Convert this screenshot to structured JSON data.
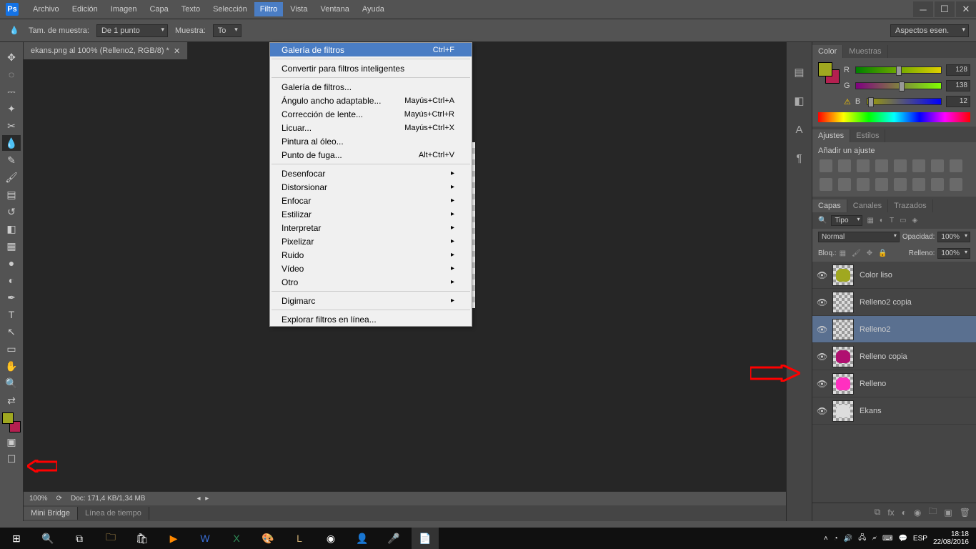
{
  "menubar": [
    "Archivo",
    "Edición",
    "Imagen",
    "Capa",
    "Texto",
    "Selección",
    "Filtro",
    "Vista",
    "Ventana",
    "Ayuda"
  ],
  "options": {
    "sample_label": "Tam. de muestra:",
    "sample_value": "De 1 punto",
    "muestra_label": "Muestra:",
    "muestra_value": "To",
    "workspace": "Aspectos esen."
  },
  "doc_tab": "ekans.png al 100% (Relleno2, RGB/8) *",
  "filter_menu": {
    "highlight": {
      "label": "Galería de filtros",
      "shortcut": "Ctrl+F"
    },
    "convert": "Convertir para filtros inteligentes",
    "g1": [
      {
        "label": "Galería de filtros...",
        "shortcut": ""
      },
      {
        "label": "Ángulo ancho adaptable...",
        "shortcut": "Mayús+Ctrl+A"
      },
      {
        "label": "Corrección de lente...",
        "shortcut": "Mayús+Ctrl+R"
      },
      {
        "label": "Licuar...",
        "shortcut": "Mayús+Ctrl+X"
      },
      {
        "label": "Pintura al óleo...",
        "shortcut": ""
      },
      {
        "label": "Punto de fuga...",
        "shortcut": "Alt+Ctrl+V"
      }
    ],
    "sub": [
      "Desenfocar",
      "Distorsionar",
      "Enfocar",
      "Estilizar",
      "Interpretar",
      "Pixelizar",
      "Ruido",
      "Vídeo",
      "Otro"
    ],
    "digimarc": "Digimarc",
    "browse": "Explorar filtros en línea..."
  },
  "status": {
    "zoom": "100%",
    "doc": "Doc: 171,4 KB/1,34 MB"
  },
  "bottom_tabs": [
    "Mini Bridge",
    "Línea de tiempo"
  ],
  "color_panel": {
    "tabs": [
      "Color",
      "Muestras"
    ],
    "r": {
      "label": "R",
      "val": "128"
    },
    "g": {
      "label": "G",
      "val": "138"
    },
    "b": {
      "label": "B",
      "val": "12"
    }
  },
  "adjust": {
    "tabs": [
      "Ajustes",
      "Estilos"
    ],
    "title": "Añadir un ajuste"
  },
  "layers_panel": {
    "tabs": [
      "Capas",
      "Canales",
      "Trazados"
    ],
    "kind": "Tipo",
    "blend": "Normal",
    "opacity_label": "Opacidad:",
    "opacity_val": "100%",
    "lock_label": "Bloq.:",
    "fill_label": "Relleno:",
    "fill_val": "100%",
    "layers": [
      {
        "name": "Color liso",
        "color": "#a0a820",
        "sel": false
      },
      {
        "name": "Relleno2 copia",
        "color": "",
        "sel": false
      },
      {
        "name": "Relleno2",
        "color": "",
        "sel": true
      },
      {
        "name": "Relleno copia",
        "color": "#b01070",
        "sel": false
      },
      {
        "name": "Relleno",
        "color": "#ff30c0",
        "sel": false
      },
      {
        "name": "Ekans",
        "color": "#ddd",
        "sel": false
      }
    ]
  },
  "taskbar": {
    "lang": "ESP",
    "time": "18:18",
    "date": "22/08/2016"
  }
}
